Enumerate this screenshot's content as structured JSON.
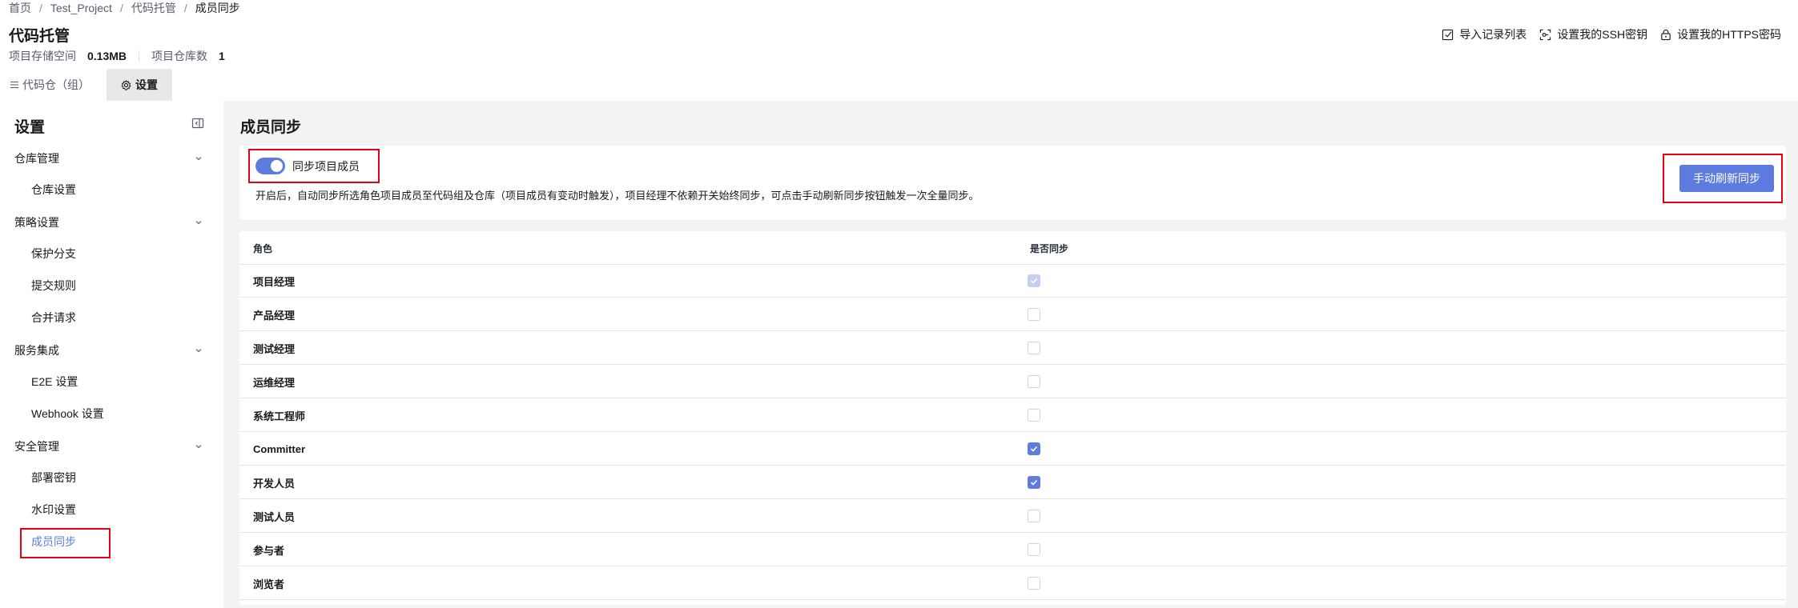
{
  "breadcrumb": [
    "首页",
    "Test_Project",
    "代码托管",
    "成员同步"
  ],
  "breadcrumb_separator": "/",
  "page_title": "代码托管",
  "stats": {
    "storage_label": "项目存储空间",
    "storage_value": "0.13MB",
    "repo_count_label": "项目仓库数",
    "repo_count_value": "1"
  },
  "header_actions": {
    "import_records": "导入记录列表",
    "ssh_key": "设置我的SSH密钥",
    "https_password": "设置我的HTTPS密码"
  },
  "tabs": {
    "repos": "代码仓（组）",
    "settings": "设置"
  },
  "sidebar": {
    "title": "设置",
    "groups": {
      "repo_management": {
        "label": "仓库管理",
        "items": [
          "仓库设置"
        ]
      },
      "policy_settings": {
        "label": "策略设置",
        "items": [
          "保护分支",
          "提交规则",
          "合并请求"
        ]
      },
      "service_integration": {
        "label": "服务集成",
        "items": [
          "E2E 设置",
          "Webhook 设置"
        ]
      },
      "security_management": {
        "label": "安全管理",
        "items": [
          "部署密钥",
          "水印设置",
          "成员同步"
        ]
      }
    },
    "active_item": "成员同步"
  },
  "content": {
    "title": "成员同步",
    "toggle_label": "同步项目成员",
    "toggle_on": true,
    "description": "开启后，自动同步所选角色项目成员至代码组及仓库（项目成员有变动时触发），项目经理不依赖开关始终同步，可点击手动刷新同步按钮触发一次全量同步。",
    "refresh_button": "手动刷新同步"
  },
  "table": {
    "headers": {
      "role": "角色",
      "sync": "是否同步"
    },
    "rows": [
      {
        "role": "项目经理",
        "synced": true,
        "disabled": true
      },
      {
        "role": "产品经理",
        "synced": false,
        "disabled": false
      },
      {
        "role": "测试经理",
        "synced": false,
        "disabled": false
      },
      {
        "role": "运维经理",
        "synced": false,
        "disabled": false
      },
      {
        "role": "系统工程师",
        "synced": false,
        "disabled": false
      },
      {
        "role": "Committer",
        "synced": true,
        "disabled": false
      },
      {
        "role": "开发人员",
        "synced": true,
        "disabled": false
      },
      {
        "role": "测试人员",
        "synced": false,
        "disabled": false
      },
      {
        "role": "参与者",
        "synced": false,
        "disabled": false
      },
      {
        "role": "浏览者",
        "synced": false,
        "disabled": false
      }
    ]
  },
  "colors": {
    "accent": "#5e7ce0",
    "highlight_box": "#e60012",
    "page_background": "#f3f3f3"
  }
}
